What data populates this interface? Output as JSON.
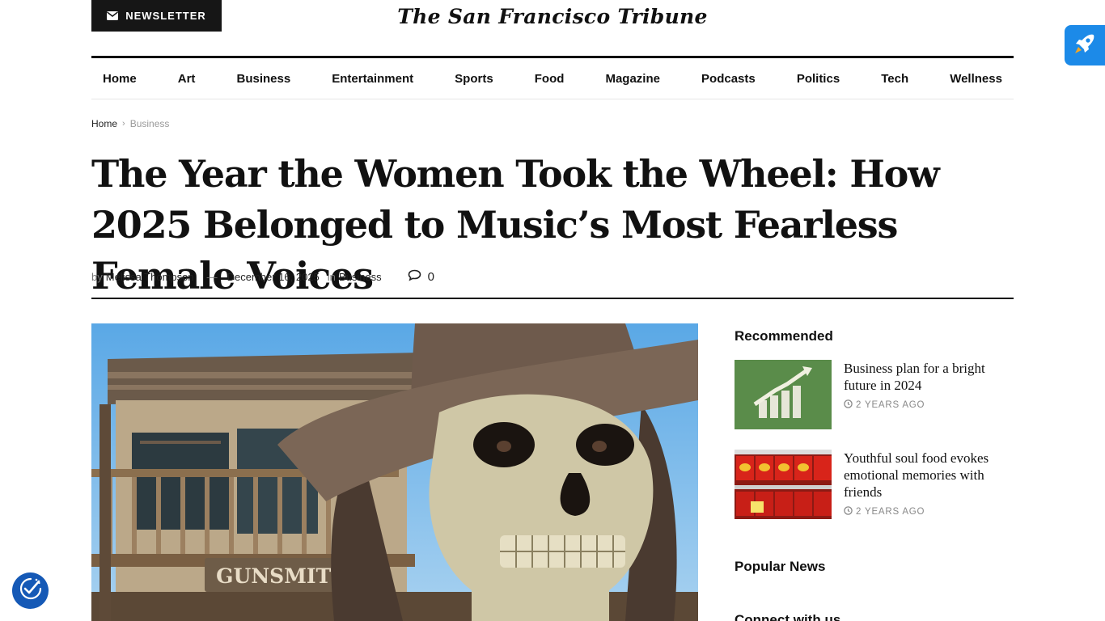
{
  "header": {
    "newsletter_label": "NEWSLETTER",
    "site_title": "The San Francisco Tribune"
  },
  "nav": {
    "items": [
      "Home",
      "Art",
      "Business",
      "Entertainment",
      "Sports",
      "Food",
      "Magazine",
      "Podcasts",
      "Politics",
      "Tech",
      "Wellness"
    ]
  },
  "breadcrumb": {
    "home": "Home",
    "current": "Business"
  },
  "article": {
    "headline": "The Year the Women Took the Wheel: How 2025 Belonged to Music’s Most Fearless Female Voices",
    "by": "by",
    "author": "Melissa Thompson",
    "dash": "—",
    "date": "December 16, 2025",
    "in": "in",
    "category": "Business",
    "comment_count": "0",
    "image_sign": "GUNSMITH"
  },
  "sidebar": {
    "recommended_title": "Recommended",
    "recommended": [
      {
        "headline": "Business plan for a bright future in 2024",
        "time": "2 YEARS AGO"
      },
      {
        "headline": "Youthful soul food evokes emotional memories with friends",
        "time": "2 YEARS AGO"
      }
    ],
    "popular_title": "Popular News",
    "connect_title": "Connect with us"
  },
  "colors": {
    "accent_blue": "#1c8ae8",
    "accessibility_blue": "#1559b6",
    "dark": "#161616"
  },
  "icons": [
    "envelope-icon",
    "rocket-icon",
    "chevron-right-icon",
    "comment-icon",
    "clock-icon",
    "accessibility-icon"
  ]
}
